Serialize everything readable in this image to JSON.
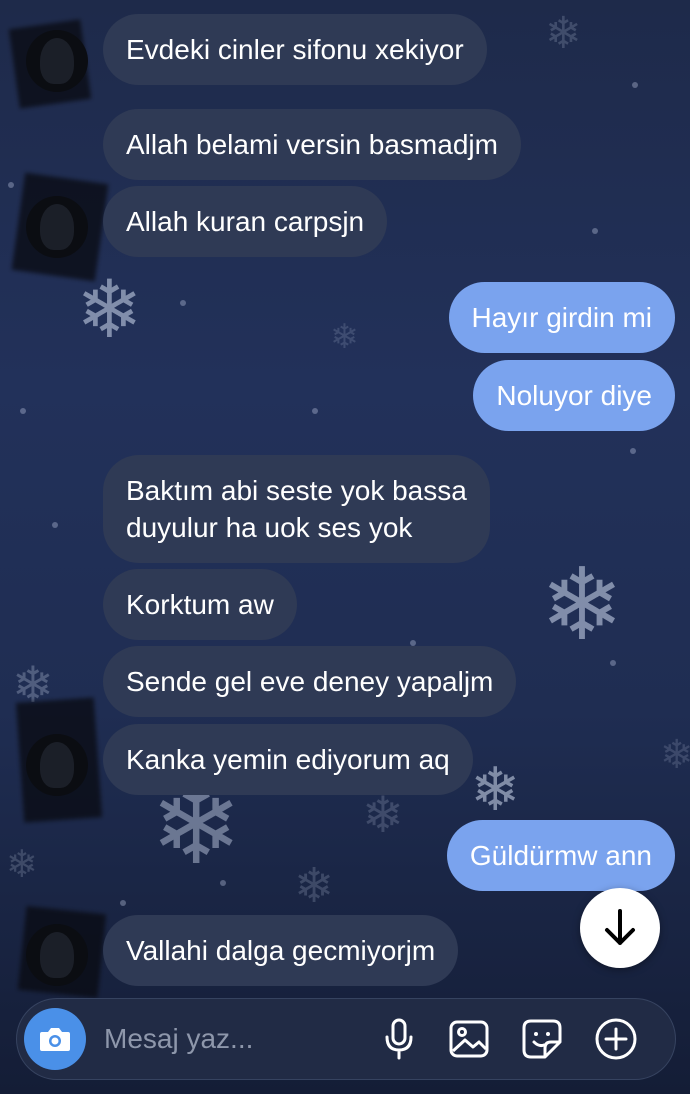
{
  "messages": [
    {
      "direction": "incoming",
      "text": "Evdeki cinler sifonu xekiyor"
    },
    {
      "direction": "incoming",
      "text": "Allah belami versin basmadjm"
    },
    {
      "direction": "incoming",
      "text": "Allah kuran carpsjn"
    },
    {
      "direction": "outgoing",
      "text": "Hayır girdin mi"
    },
    {
      "direction": "outgoing",
      "text": "Noluyor diye"
    },
    {
      "direction": "incoming",
      "text": "Baktım abi seste yok bassa duyulur ha uok ses yok",
      "line1": "Baktım abi seste yok bassa",
      "line2": "duyulur ha uok ses yok"
    },
    {
      "direction": "incoming",
      "text": "Korktum aw"
    },
    {
      "direction": "incoming",
      "text": "Sende gel eve deney yapaljm"
    },
    {
      "direction": "incoming",
      "text": "Kanka yemin ediyorum aq"
    },
    {
      "direction": "outgoing",
      "text": "Güldürmw ann"
    },
    {
      "direction": "incoming",
      "text": "Vallahi dalga gecmiyorjm"
    }
  ],
  "composer": {
    "placeholder": "Mesaj yaz...",
    "icons": [
      "camera-icon",
      "microphone-icon",
      "gallery-icon",
      "sticker-icon",
      "plus-icon"
    ]
  },
  "scroll_button": {
    "icon": "arrow-down-icon"
  },
  "colors": {
    "incoming_bubble": "#2f3a55",
    "outgoing_bubble": "#7aa3ee",
    "camera_button": "#4a90e8",
    "background": "#1f2d52"
  }
}
